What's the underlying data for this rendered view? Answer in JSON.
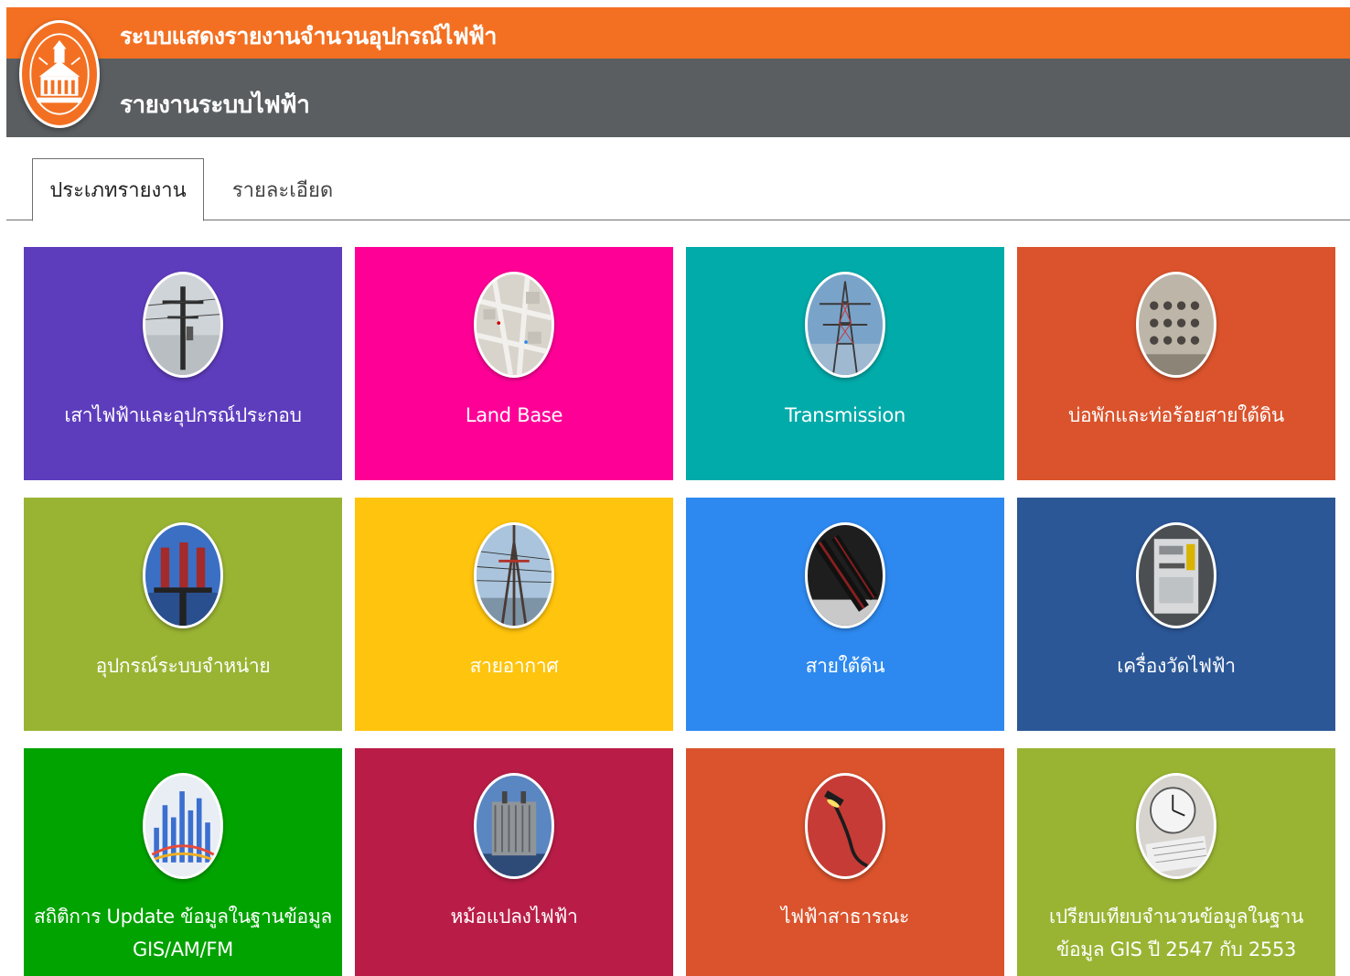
{
  "header": {
    "app_title": "ระบบแสดงรายงานจำนวนอุปกรณ์ไฟฟ้า",
    "page_title": "รายงานระบบไฟฟ้า",
    "top_color": "#f37022",
    "sub_color": "#5a5e61"
  },
  "logo": {
    "icon": "city-hall-emblem-icon"
  },
  "tabs": [
    {
      "label": "ประเภทรายงาน",
      "active": true
    },
    {
      "label": "รายละเอียด",
      "active": false
    }
  ],
  "tiles": [
    {
      "label": "เสาไฟฟ้าและอุปกรณ์ประกอบ",
      "color": "#5e3dbd",
      "icon": "utility-pole-icon"
    },
    {
      "label": "Land Base",
      "color": "#ff0097",
      "icon": "map-icon"
    },
    {
      "label": "Transmission",
      "color": "#00aba9",
      "icon": "transmission-tower-icon"
    },
    {
      "label": "บ่อพักและท่อร้อยสายใต้ดิน",
      "color": "#da532c",
      "icon": "conduit-pipes-icon"
    },
    {
      "label": "อุปกรณ์ระบบจำหน่าย",
      "color": "#99b433",
      "icon": "distribution-equipment-icon"
    },
    {
      "label": "สายอากาศ",
      "color": "#ffc40d",
      "icon": "overhead-cable-icon"
    },
    {
      "label": "สายใต้ดิน",
      "color": "#2d89ef",
      "icon": "underground-cable-icon"
    },
    {
      "label": "เครื่องวัดไฟฟ้า",
      "color": "#2b5797",
      "icon": "electric-meter-icon"
    },
    {
      "label": "สถิติการ Update ข้อมูลในฐานข้อมูล GIS/AM/FM",
      "color": "#00a300",
      "icon": "statistics-chart-icon"
    },
    {
      "label": "หม้อแปลงไฟฟ้า",
      "color": "#b91d47",
      "icon": "transformer-icon"
    },
    {
      "label": "ไฟฟ้าสาธารณะ",
      "color": "#da532c",
      "icon": "street-light-icon"
    },
    {
      "label": "เปรียบเทียบจำนวนข้อมูลในฐานข้อมูล GIS ปี 2547 กับ 2553",
      "color": "#99b433",
      "icon": "clock-compare-icon"
    }
  ]
}
